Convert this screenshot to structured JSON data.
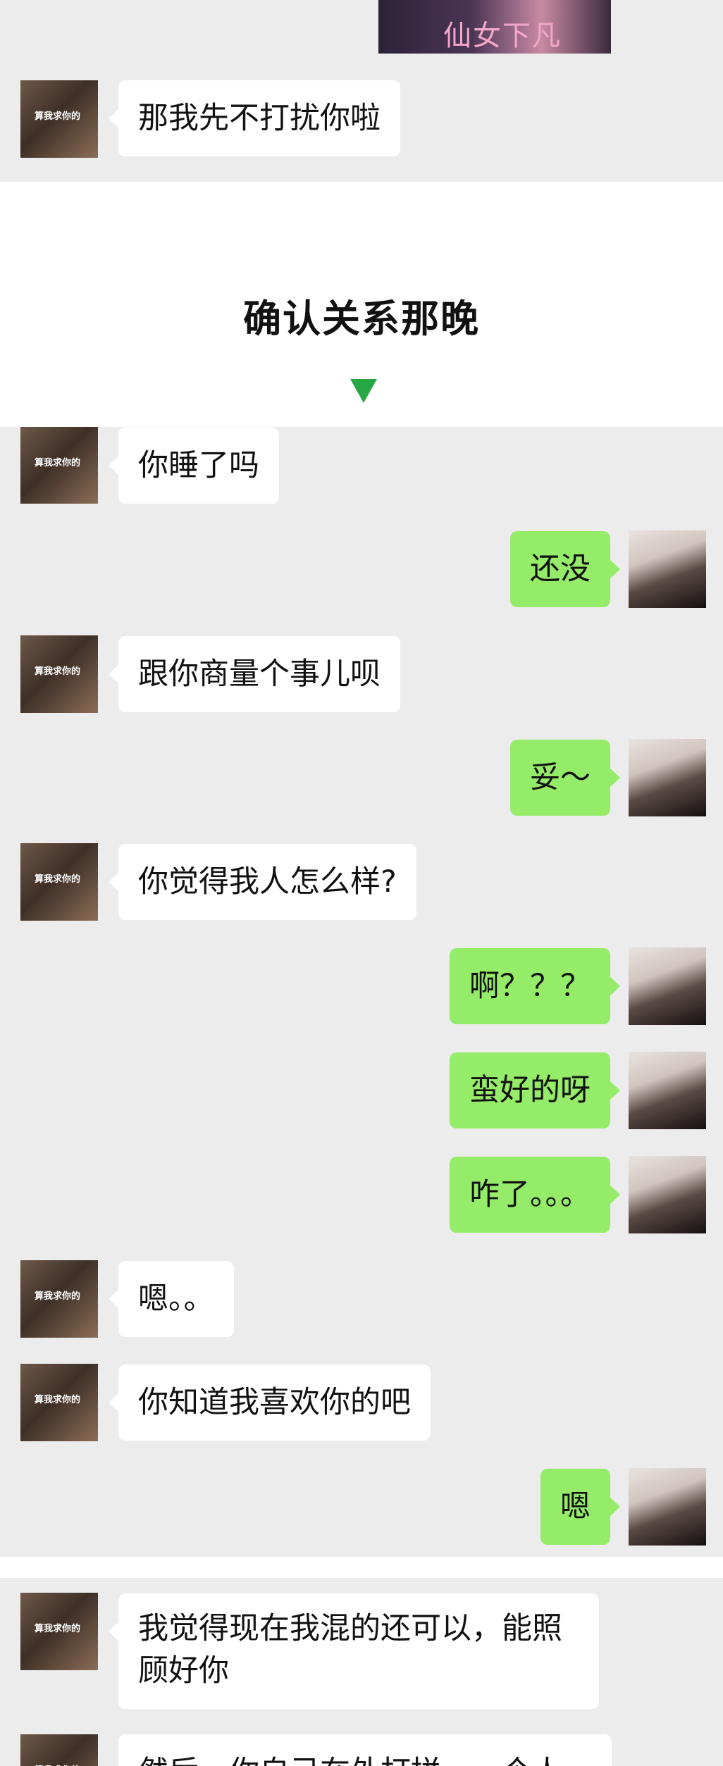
{
  "top_panel": {
    "sticker_caption": "仙女下凡",
    "last_message": "那我先不打扰你啦"
  },
  "section_title": "确认关系那晚",
  "avatars": {
    "friend_avatar_text": "算我求你的"
  },
  "chat": {
    "m1": "你睡了吗",
    "m2": "还没",
    "m3": "跟你商量个事儿呗",
    "m4": "妥～",
    "m5": "你觉得我人怎么样?",
    "m6": "啊？？？",
    "m7": "蛮好的呀",
    "m8": "咋了。。。",
    "m9": "嗯。。",
    "m10": "你知道我喜欢你的吧",
    "m11": "嗯"
  },
  "chat2": {
    "m1": "我觉得现在我混的还可以，能照顾好你",
    "m2": "然后，你自己在外打拼，一个人"
  },
  "colors": {
    "panel_bg": "#ececec",
    "friend_bubble": "#ffffff",
    "my_bubble": "#95ec69",
    "arrow": "#27a744"
  }
}
